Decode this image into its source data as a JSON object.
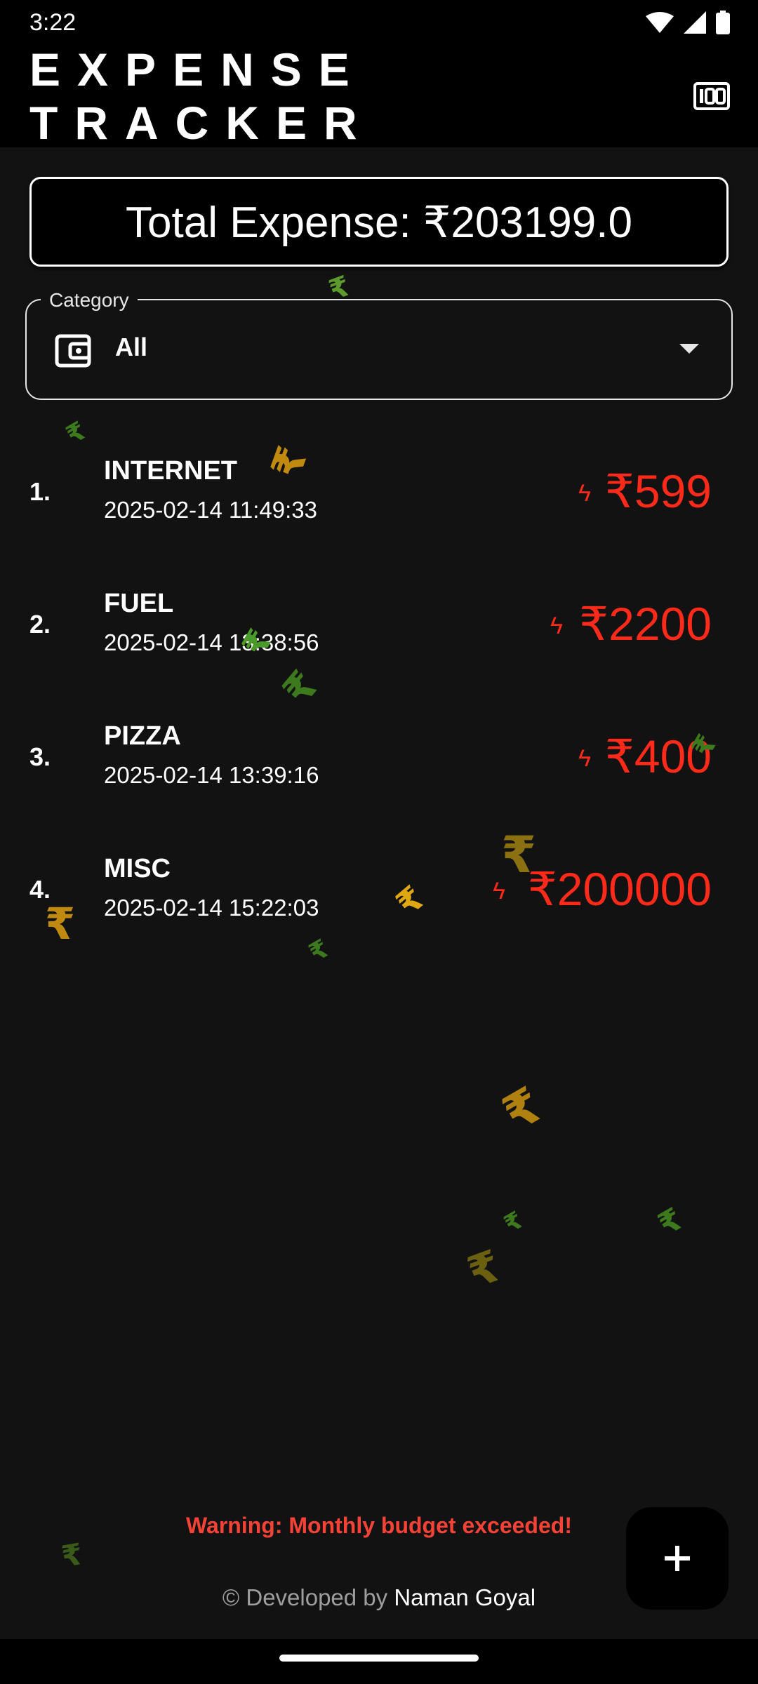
{
  "status_bar": {
    "time": "3:22"
  },
  "app_bar": {
    "title": "EXPENSE TRACKER",
    "budget_icon": "budget-100-icon"
  },
  "total": {
    "text": "Total Expense: ₹203199.0"
  },
  "category": {
    "label": "Category",
    "value": "All",
    "icon": "wallet-icon"
  },
  "expenses": [
    {
      "index": "1.",
      "name": "INTERNET",
      "date": "2025-02-14 11:49:33",
      "amount": "₹599"
    },
    {
      "index": "2.",
      "name": "FUEL",
      "date": "2025-02-14 13:38:56",
      "amount": "₹2200"
    },
    {
      "index": "3.",
      "name": "PIZZA",
      "date": "2025-02-14 13:39:16",
      "amount": "₹400"
    },
    {
      "index": "4.",
      "name": "MISC",
      "date": "2025-02-14 15:22:03",
      "amount": "₹200000"
    }
  ],
  "warning": "Warning: Monthly budget exceeded!",
  "footer": {
    "prefix": "© Developed by",
    "name": "Naman Goyal"
  },
  "fab_icon": "plus-icon",
  "colors": {
    "background": "#121212",
    "bar": "#000000",
    "amount": "#ff2a1a",
    "warning": "#f44336",
    "rupee_green": "#4a8a2a",
    "rupee_gold": "#c08a10"
  }
}
